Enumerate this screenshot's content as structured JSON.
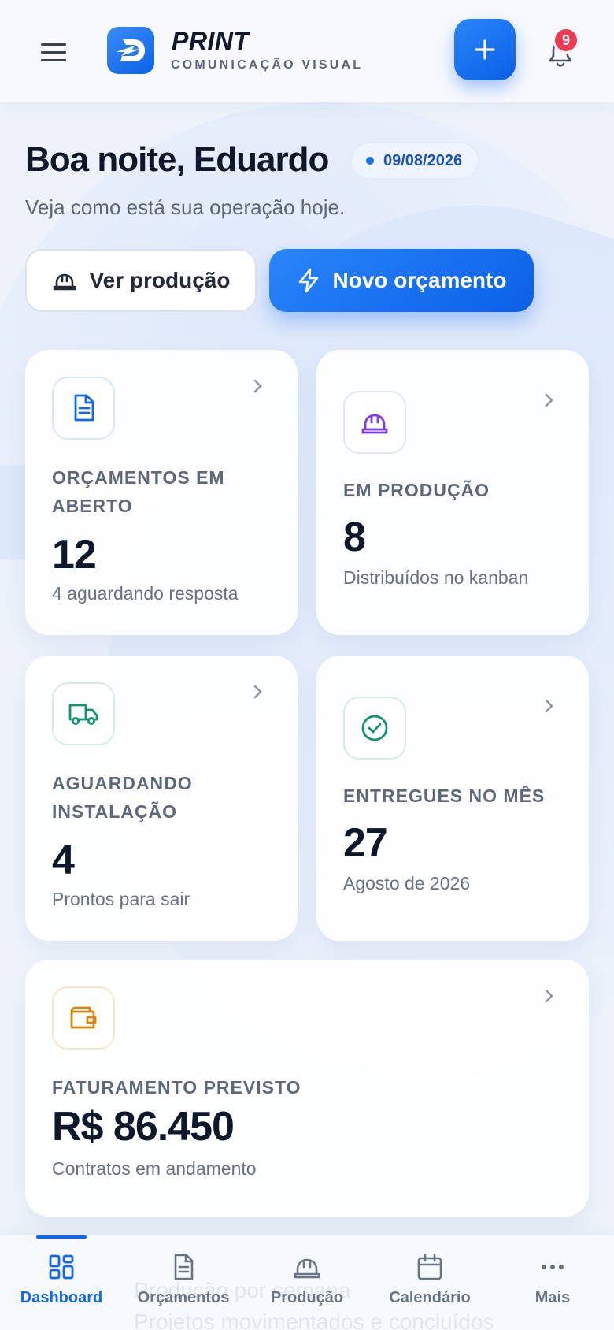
{
  "header": {
    "brand_name": "PRINT",
    "brand_subtitle": "COMUNICAÇÃO VISUAL",
    "notification_count": "9"
  },
  "hero": {
    "greeting": "Boa noite, Eduardo",
    "date": "09/08/2026",
    "subtitle": "Veja como está sua operação hoje.",
    "view_production_label": "Ver produção",
    "new_quote_label": "Novo orçamento"
  },
  "cards": [
    {
      "label": "ORÇAMENTOS EM ABERTO",
      "value": "12",
      "note": "4 aguardando resposta",
      "icon": "document-icon",
      "color": "#1167ee"
    },
    {
      "label": "EM PRODUÇÃO",
      "value": "8",
      "note": "Distribuídos no kanban",
      "icon": "hard-hat-icon",
      "color": "#7c3aed"
    },
    {
      "label": "AGUARDANDO INSTALAÇÃO",
      "value": "4",
      "note": "Prontos para sair",
      "icon": "truck-icon",
      "color": "#0f9470"
    },
    {
      "label": "ENTREGUES NO MÊS",
      "value": "27",
      "note": "Agosto de 2026",
      "icon": "check-circle-icon",
      "color": "#0f9470"
    },
    {
      "label": "FATURAMENTO PREVISTO",
      "value": "R$ 86.450",
      "note": "Contratos em andamento",
      "icon": "wallet-icon",
      "color": "#d48612"
    }
  ],
  "behind_nav": {
    "title": "Produção por semana",
    "subtitle": "Projetos movimentados e concluídos"
  },
  "nav": {
    "items": [
      {
        "label": "Dashboard",
        "icon": "grid-icon",
        "active": true
      },
      {
        "label": "Orçamentos",
        "icon": "document-icon"
      },
      {
        "label": "Produção",
        "icon": "hard-hat-icon"
      },
      {
        "label": "Calendário",
        "icon": "calendar-icon"
      },
      {
        "label": "Mais",
        "icon": "more-icon"
      }
    ]
  },
  "colors": {
    "primary": "#1167ee",
    "badge": "#ee3b52"
  }
}
